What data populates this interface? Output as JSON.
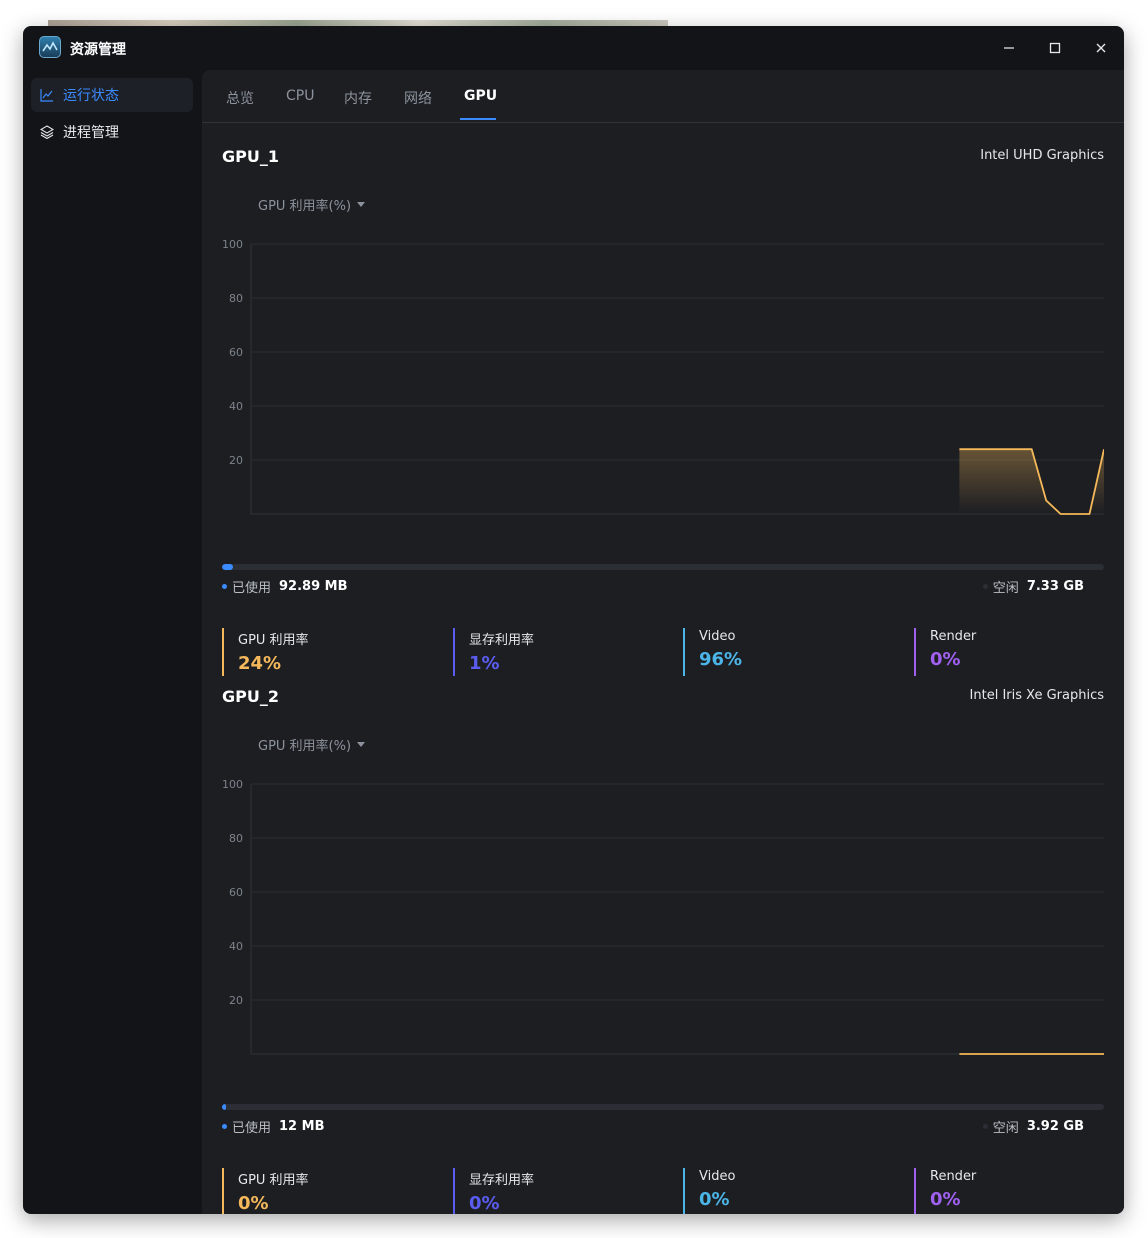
{
  "app": {
    "title": "资源管理"
  },
  "sidebar": {
    "items": [
      {
        "label": "运行状态",
        "icon": "line-chart-icon"
      },
      {
        "label": "进程管理",
        "icon": "layers-icon"
      }
    ]
  },
  "tabs": [
    {
      "label": "总览"
    },
    {
      "label": "CPU"
    },
    {
      "label": "内存"
    },
    {
      "label": "网络"
    },
    {
      "label": "GPU"
    }
  ],
  "active_tab": "GPU",
  "colors": {
    "accent": "#3b8bff",
    "gpu_util": "#f5b85a",
    "vram_util": "#5b5cf0",
    "video": "#4cb5e8",
    "render": "#a060f0"
  },
  "gpus": [
    {
      "name": "GPU_1",
      "model": "Intel UHD Graphics",
      "metric_select": "GPU 利用率(%)",
      "memory": {
        "used_label": "已使用",
        "used_value": "92.89 MB",
        "free_label": "空闲",
        "free_value": "7.33 GB",
        "used_fraction": 0.012
      },
      "stats": [
        {
          "label": "GPU 利用率",
          "value": "24%"
        },
        {
          "label": "显存利用率",
          "value": "1%"
        },
        {
          "label": "Video",
          "value": "96%"
        },
        {
          "label": "Render",
          "value": "0%"
        }
      ]
    },
    {
      "name": "GPU_2",
      "model": "Intel Iris Xe Graphics",
      "metric_select": "GPU 利用率(%)",
      "memory": {
        "used_label": "已使用",
        "used_value": "12 MB",
        "free_label": "空闲",
        "free_value": "3.92 GB",
        "used_fraction": 0.003
      },
      "stats": [
        {
          "label": "GPU 利用率",
          "value": "0%"
        },
        {
          "label": "显存利用率",
          "value": "0%"
        },
        {
          "label": "Video",
          "value": "0%"
        },
        {
          "label": "Render",
          "value": "0%"
        }
      ]
    }
  ],
  "chart_data": [
    {
      "type": "area",
      "ylim": [
        0,
        100
      ],
      "yticks": [
        20,
        40,
        60,
        80,
        100
      ],
      "grid": true,
      "x": [
        0,
        1,
        2,
        3,
        4,
        5,
        6,
        7,
        8,
        9,
        10,
        11,
        12,
        13,
        14,
        15,
        16,
        17,
        18,
        19,
        20,
        21,
        22,
        23,
        24,
        25,
        26,
        27,
        28,
        29,
        30,
        31,
        32,
        33,
        34,
        35,
        36,
        37,
        38,
        39,
        40,
        41,
        42,
        43,
        44,
        45,
        46,
        47,
        48,
        49,
        50,
        51,
        52,
        53,
        54,
        55,
        56,
        57,
        58,
        59
      ],
      "series": [
        {
          "values": [
            null,
            null,
            null,
            null,
            null,
            null,
            null,
            null,
            null,
            null,
            null,
            null,
            null,
            null,
            null,
            null,
            null,
            null,
            null,
            null,
            null,
            null,
            null,
            null,
            null,
            null,
            null,
            null,
            null,
            null,
            null,
            null,
            null,
            null,
            null,
            null,
            null,
            null,
            null,
            null,
            null,
            null,
            null,
            null,
            null,
            null,
            null,
            null,
            null,
            24,
            24,
            24,
            24,
            24,
            24,
            5,
            0,
            0,
            0,
            24
          ]
        }
      ]
    },
    {
      "type": "area",
      "ylim": [
        0,
        100
      ],
      "yticks": [
        20,
        40,
        60,
        80,
        100
      ],
      "grid": true,
      "x": [
        0,
        1,
        2,
        3,
        4,
        5,
        6,
        7,
        8,
        9,
        10,
        11,
        12,
        13,
        14,
        15,
        16,
        17,
        18,
        19,
        20,
        21,
        22,
        23,
        24,
        25,
        26,
        27,
        28,
        29,
        30,
        31,
        32,
        33,
        34,
        35,
        36,
        37,
        38,
        39,
        40,
        41,
        42,
        43,
        44,
        45,
        46,
        47,
        48,
        49,
        50,
        51,
        52,
        53,
        54,
        55,
        56,
        57,
        58,
        59
      ],
      "series": [
        {
          "values": [
            null,
            null,
            null,
            null,
            null,
            null,
            null,
            null,
            null,
            null,
            null,
            null,
            null,
            null,
            null,
            null,
            null,
            null,
            null,
            null,
            null,
            null,
            null,
            null,
            null,
            null,
            null,
            null,
            null,
            null,
            null,
            null,
            null,
            null,
            null,
            null,
            null,
            null,
            null,
            null,
            null,
            null,
            null,
            null,
            null,
            null,
            null,
            null,
            null,
            0,
            0,
            0,
            0,
            0,
            0,
            0,
            0,
            0,
            0,
            0
          ]
        }
      ]
    }
  ]
}
